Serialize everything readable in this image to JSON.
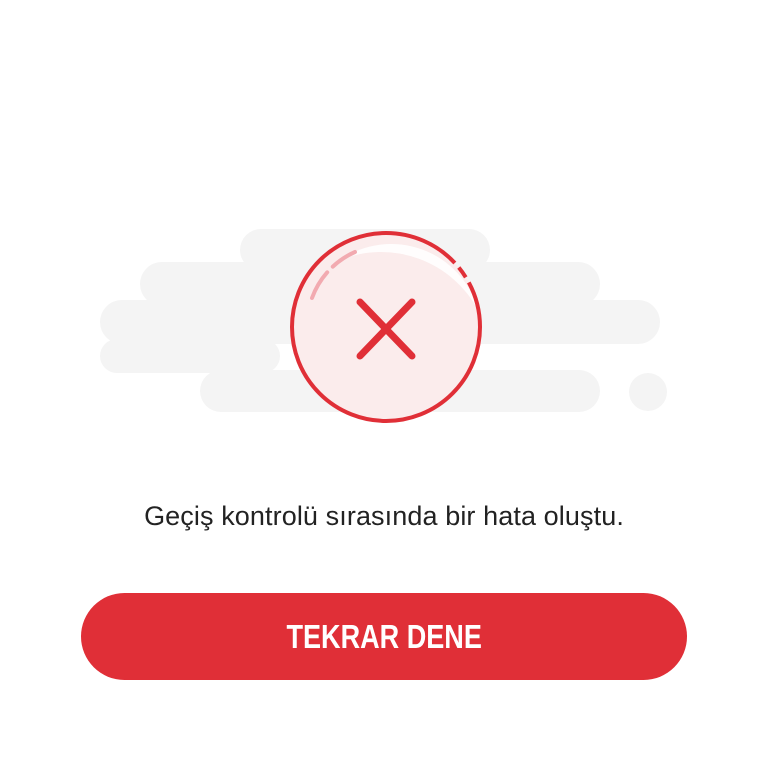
{
  "error": {
    "icon": "error-x-circle-icon",
    "message": "Geçiş kontrolü sırasında bir hata oluştu."
  },
  "actions": {
    "retry_label": "TEKRAR DENE"
  },
  "colors": {
    "accent": "#e02f37",
    "cloud": "#f4f4f4",
    "text": "#222222",
    "background": "#ffffff"
  }
}
